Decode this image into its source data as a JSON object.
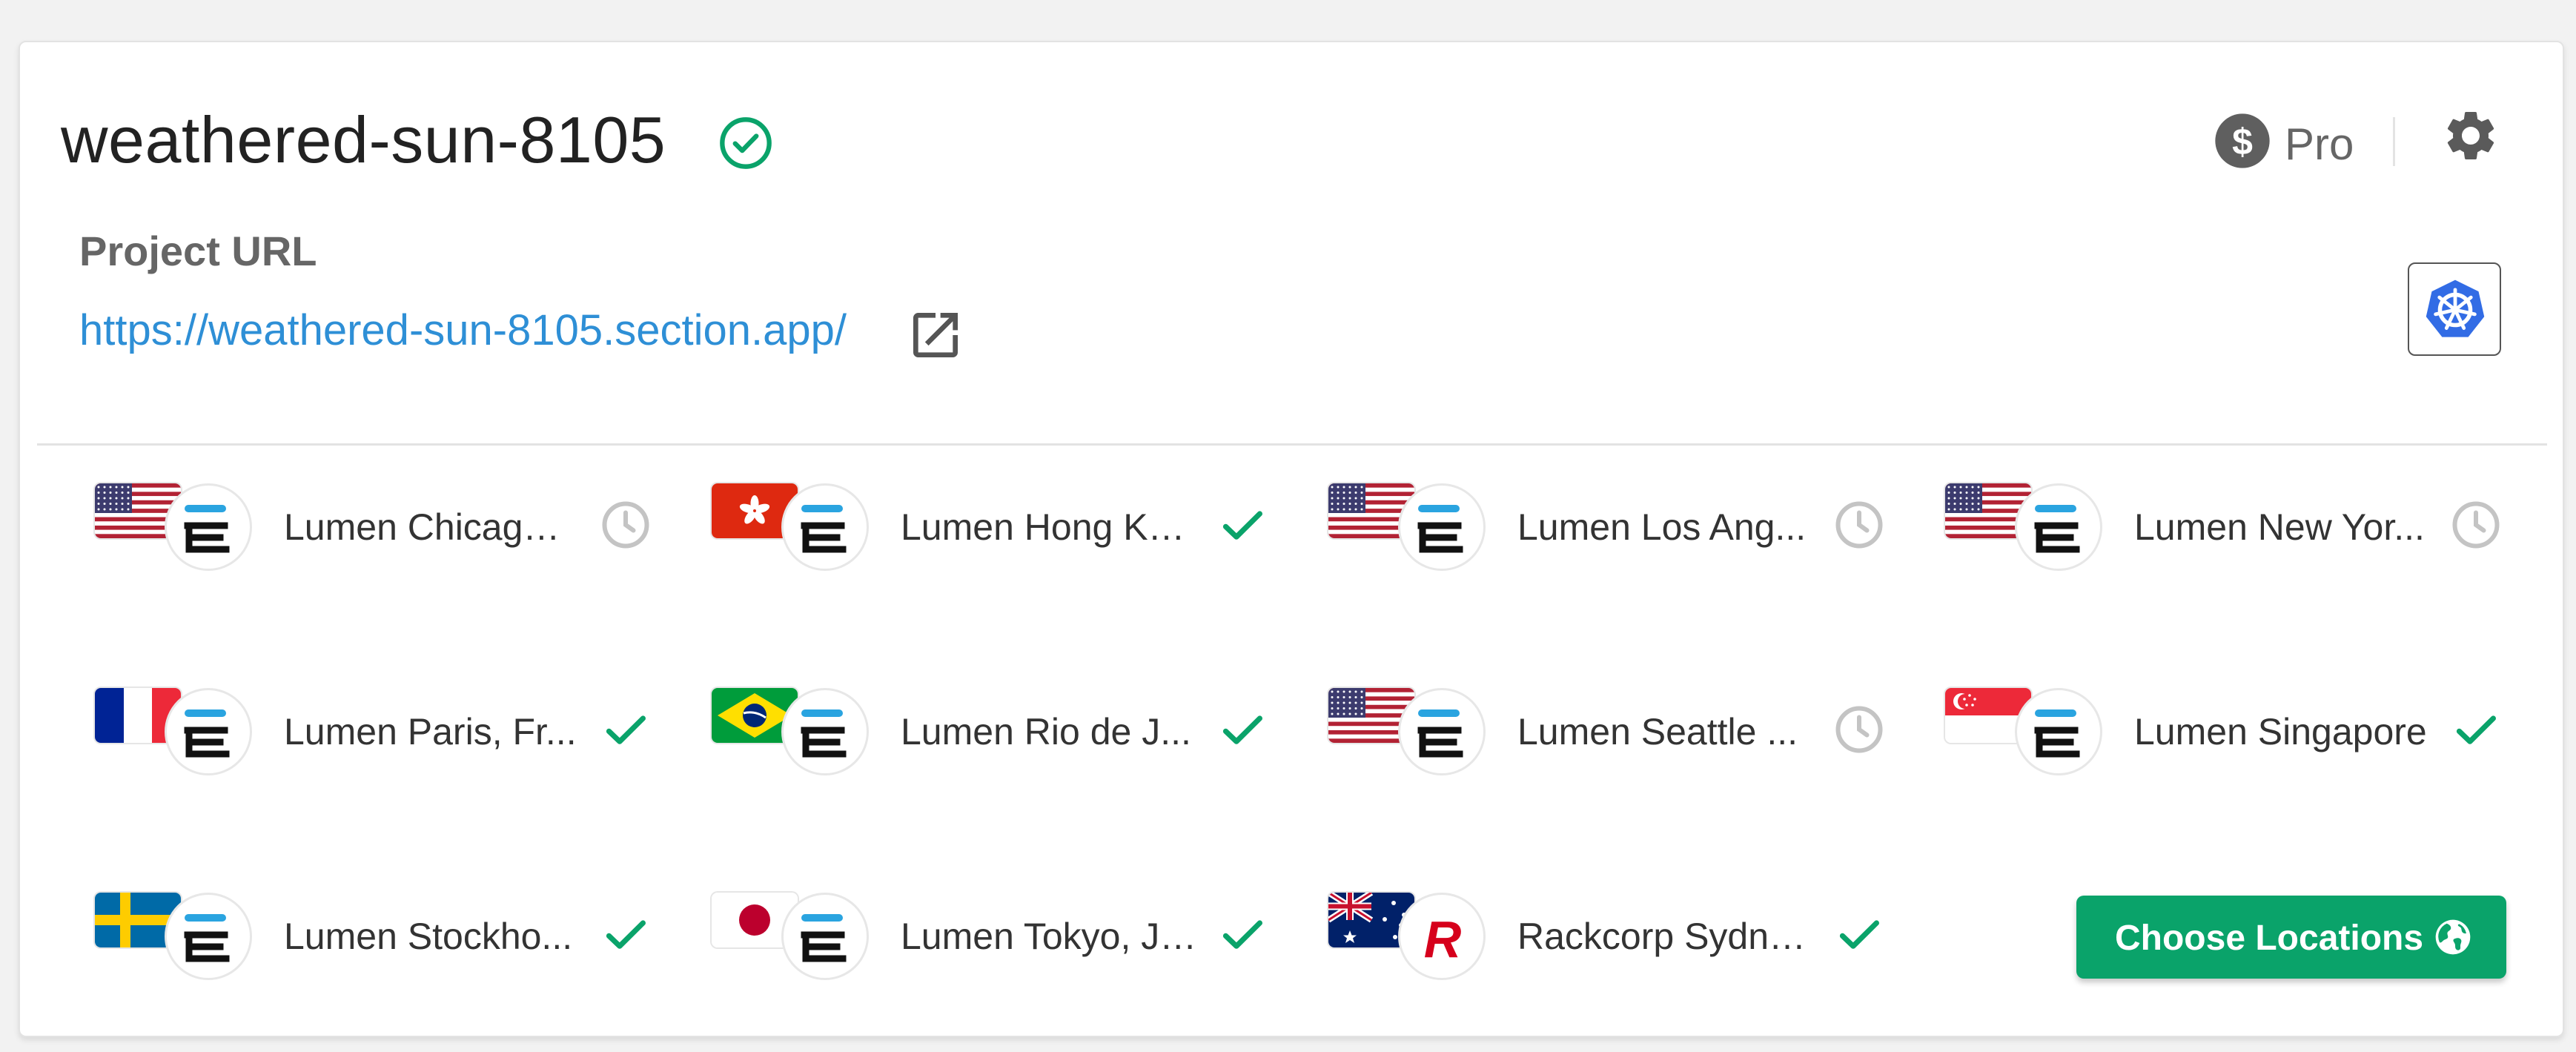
{
  "project": {
    "name": "weathered-sun-8105",
    "url_label": "Project URL",
    "url": "https://weathered-sun-8105.section.app/",
    "plan": "Pro",
    "status": "check-circle-icon"
  },
  "colors": {
    "accent_green": "#0aa36a",
    "link_blue": "#2e8fd6",
    "status_pending": "#c4c4c4"
  },
  "locations": [
    {
      "name": "Lumen Chicago ...",
      "flag": "US",
      "provider": "lumen",
      "status": "pending"
    },
    {
      "name": "Lumen Hong Ko...",
      "flag": "HK",
      "provider": "lumen",
      "status": "active"
    },
    {
      "name": "Lumen Los Ang...",
      "flag": "US",
      "provider": "lumen",
      "status": "pending"
    },
    {
      "name": "Lumen New Yor...",
      "flag": "US",
      "provider": "lumen",
      "status": "pending"
    },
    {
      "name": "Lumen Paris, Fr...",
      "flag": "FR",
      "provider": "lumen",
      "status": "active"
    },
    {
      "name": "Lumen Rio de J...",
      "flag": "BR",
      "provider": "lumen",
      "status": "active"
    },
    {
      "name": "Lumen Seattle ...",
      "flag": "US",
      "provider": "lumen",
      "status": "pending"
    },
    {
      "name": "Lumen Singapore",
      "flag": "SG",
      "provider": "lumen",
      "status": "active"
    },
    {
      "name": "Lumen Stockho...",
      "flag": "SE",
      "provider": "lumen",
      "status": "active"
    },
    {
      "name": "Lumen Tokyo, Ja...",
      "flag": "JP",
      "provider": "lumen",
      "status": "active"
    },
    {
      "name": "Rackcorp Sydne...",
      "flag": "AU",
      "provider": "rackcorp",
      "status": "active"
    }
  ],
  "choose_button": {
    "label": "Choose Locations",
    "icon": "globe-icon"
  }
}
